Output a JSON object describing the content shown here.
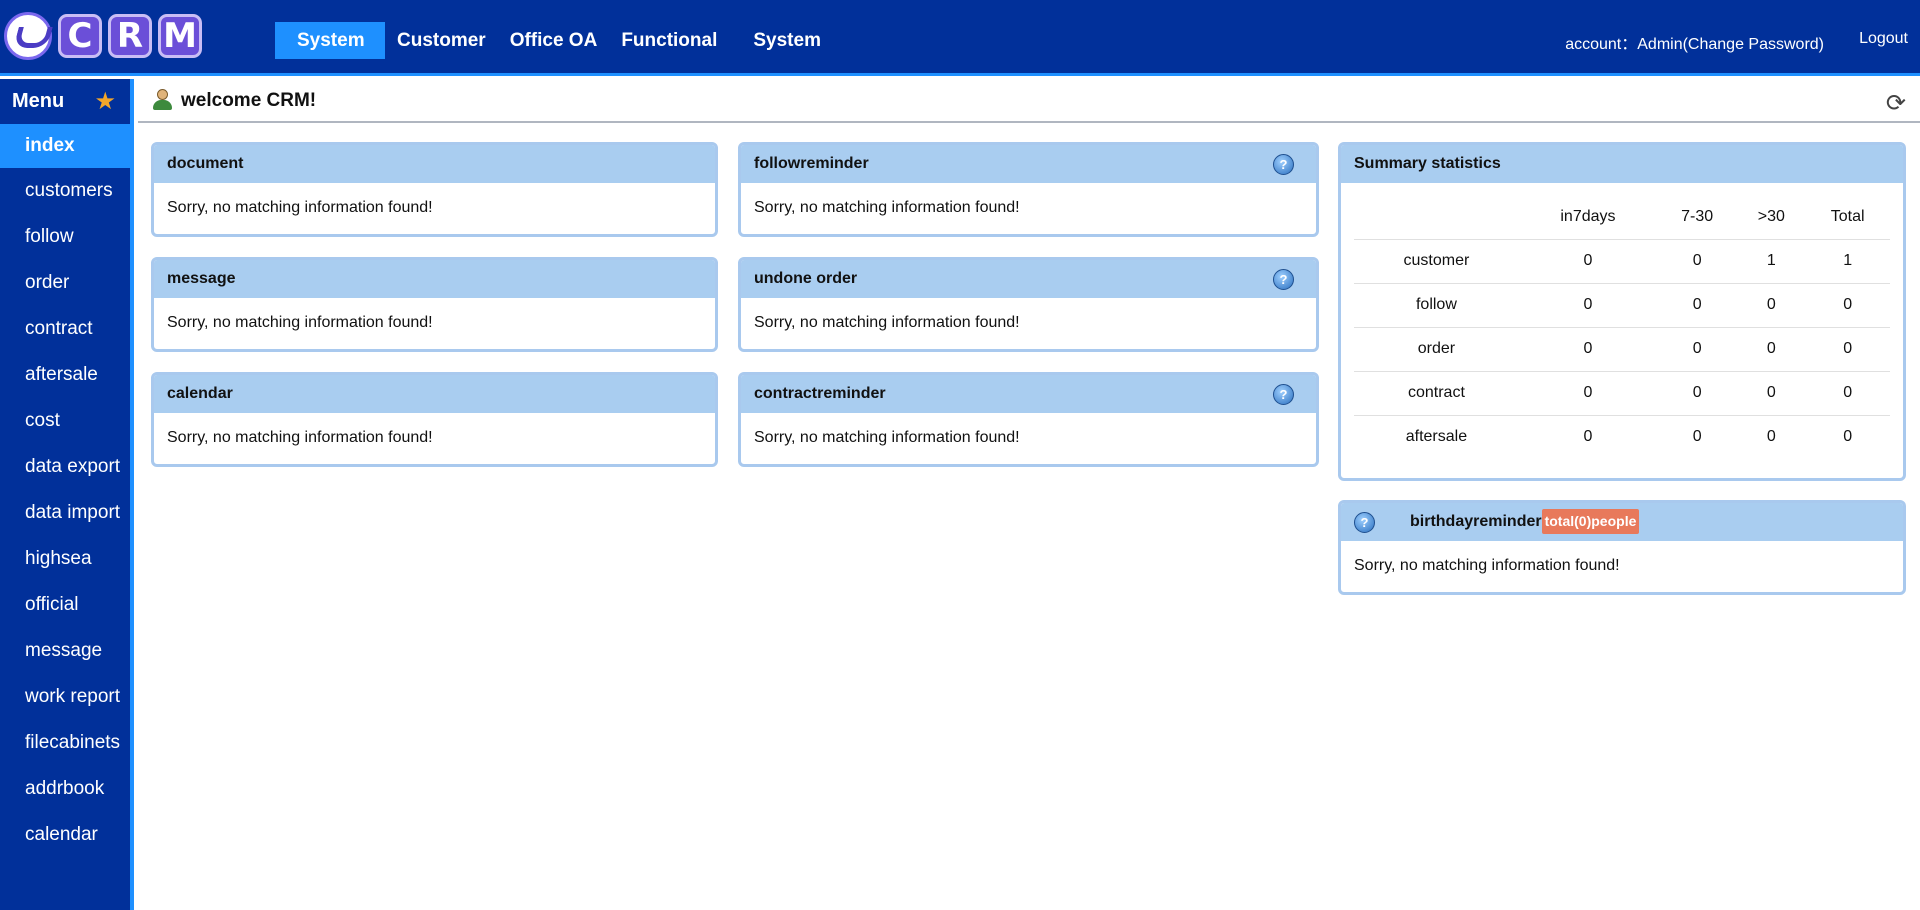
{
  "header": {
    "logo_letters": [
      "C",
      "R",
      "M"
    ],
    "nav": [
      {
        "label": "System"
      },
      {
        "label": "Customer"
      },
      {
        "label": "Office OA"
      },
      {
        "label": "Functional"
      },
      {
        "label": "System"
      }
    ],
    "account_text": "account：Admin(Change Password)",
    "logout": "Logout"
  },
  "sidebar": {
    "title": "Menu",
    "items": [
      {
        "label": "index"
      },
      {
        "label": "customers"
      },
      {
        "label": "follow"
      },
      {
        "label": "order"
      },
      {
        "label": "contract"
      },
      {
        "label": "aftersale"
      },
      {
        "label": "cost"
      },
      {
        "label": "data export"
      },
      {
        "label": "data import"
      },
      {
        "label": "highsea"
      },
      {
        "label": "official"
      },
      {
        "label": "message"
      },
      {
        "label": "work report"
      },
      {
        "label": "filecabinets"
      },
      {
        "label": "addrbook"
      },
      {
        "label": "calendar"
      }
    ]
  },
  "main": {
    "welcome": "welcome CRM!",
    "empty_text": "Sorry, no matching information found!",
    "panels": {
      "document": "document",
      "message": "message",
      "calendar": "calendar",
      "followreminder": "followreminder",
      "undone_order": "undone order",
      "contractreminder": "contractreminder",
      "summary": "Summary statistics",
      "birthday": "birthdayreminder",
      "birthday_badge": "total(0)people"
    },
    "summary_table": {
      "columns": [
        "",
        "in7days",
        "7-30",
        ">30",
        "Total"
      ],
      "rows": [
        [
          "customer",
          "0",
          "0",
          "1",
          "1"
        ],
        [
          "follow",
          "0",
          "0",
          "0",
          "0"
        ],
        [
          "order",
          "0",
          "0",
          "0",
          "0"
        ],
        [
          "contract",
          "0",
          "0",
          "0",
          "0"
        ],
        [
          "aftersale",
          "0",
          "0",
          "0",
          "0"
        ]
      ]
    }
  },
  "icons": {
    "star": "star-icon",
    "help": "help-icon",
    "refresh": "refresh-icon",
    "user": "user-icon"
  },
  "colors": {
    "topbar": "#01309a",
    "accent": "#1e90ff",
    "panel_header": "#a9cdf0",
    "badge": "#e8795b"
  }
}
